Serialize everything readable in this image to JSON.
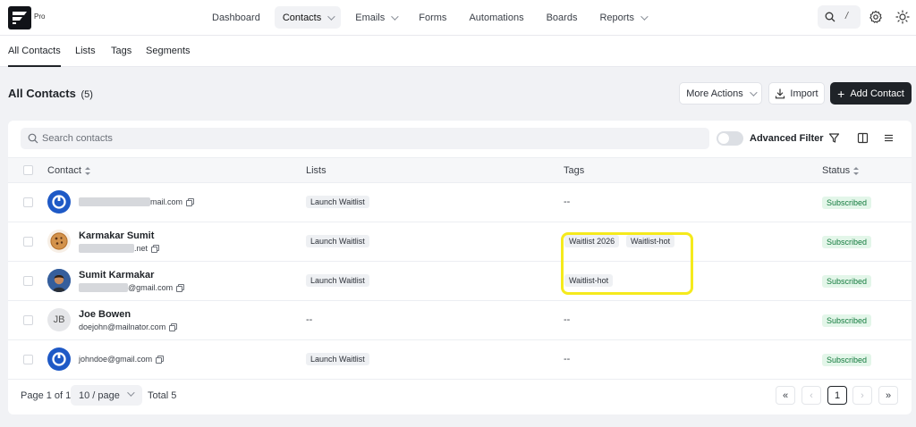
{
  "app": {
    "badge": "Pro"
  },
  "nav": {
    "items": [
      {
        "label": "Dashboard",
        "has_dropdown": false
      },
      {
        "label": "Contacts",
        "has_dropdown": true,
        "active": true
      },
      {
        "label": "Emails",
        "has_dropdown": true
      },
      {
        "label": "Forms",
        "has_dropdown": false
      },
      {
        "label": "Automations",
        "has_dropdown": false
      },
      {
        "label": "Boards",
        "has_dropdown": false
      },
      {
        "label": "Reports",
        "has_dropdown": true
      }
    ],
    "search_shortcut": "/"
  },
  "subtabs": [
    "All Contacts",
    "Lists",
    "Tags",
    "Segments"
  ],
  "page": {
    "title": "All Contacts",
    "count": "(5)"
  },
  "actions": {
    "more": "More Actions",
    "import": "Import",
    "add": "Add Contact"
  },
  "search": {
    "placeholder": "Search contacts"
  },
  "filter": {
    "advanced_label": "Advanced Filter",
    "advanced_enabled": false
  },
  "table": {
    "columns": [
      "Contact",
      "Lists",
      "Tags",
      "Status"
    ],
    "rows": [
      {
        "name": "",
        "email": "mail.com",
        "email_redacted": true,
        "avatar": "power-icon",
        "lists": [
          "Launch Waitlist"
        ],
        "tags": [],
        "tags_empty": "--",
        "status": "Subscribed"
      },
      {
        "name": "Karmakar Sumit",
        "email": ".net",
        "email_redacted": true,
        "avatar": "cookie-photo",
        "lists": [
          "Launch Waitlist"
        ],
        "tags": [
          "Waitlist 2026",
          "Waitlist-hot"
        ],
        "status": "Subscribed"
      },
      {
        "name": "Sumit Karmakar",
        "email": "@gmail.com",
        "email_redacted": true,
        "avatar": "person-photo",
        "lists": [
          "Launch Waitlist"
        ],
        "tags": [
          "Waitlist-hot"
        ],
        "status": "Subscribed"
      },
      {
        "name": "Joe Bowen",
        "email": "doejohn@mailnator.com",
        "email_redacted": false,
        "avatar": "JB",
        "lists": [],
        "lists_empty": "--",
        "tags": [],
        "tags_empty": "--",
        "status": "Subscribed"
      },
      {
        "name": "",
        "email": "johndoe@gmail.com",
        "email_redacted": false,
        "avatar": "power-icon",
        "lists": [
          "Launch Waitlist"
        ],
        "tags": [],
        "tags_empty": "--",
        "status": "Subscribed"
      }
    ]
  },
  "pagination": {
    "page_text": "Page 1 of 1",
    "per_page": "10 / page",
    "total": "Total 5",
    "current": "1"
  },
  "colors": {
    "accent_dark": "#1f2328",
    "status_green": "#137a3d",
    "status_bg": "#e3f6e9",
    "avatar_blue": "#1e59c6",
    "highlight": "#f5ea1c"
  }
}
